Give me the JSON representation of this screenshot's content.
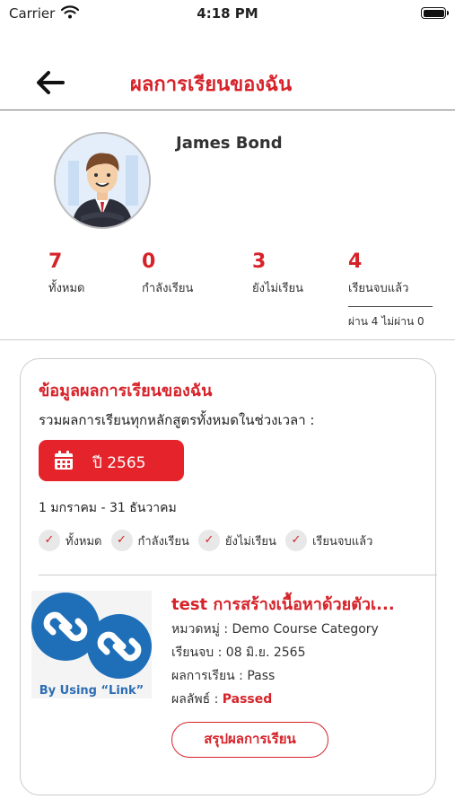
{
  "status_bar": {
    "carrier": "Carrier",
    "time": "4:18 PM"
  },
  "header": {
    "title": "ผลการเรียนของฉัน"
  },
  "profile": {
    "name": "James Bond"
  },
  "stats": [
    {
      "value": "7",
      "label": "ทั้งหมด"
    },
    {
      "value": "0",
      "label": "กำลังเรียน"
    },
    {
      "value": "3",
      "label": "ยังไม่เรียน"
    },
    {
      "value": "4",
      "label": "เรียนจบแล้ว"
    }
  ],
  "pass_summary": "ผ่าน 4 ไม่ผ่าน 0",
  "card": {
    "title": "ข้อมูลผลการเรียนของฉัน",
    "subtitle": "รวมผลการเรียนทุกหลักสูตรทั้งหมดในช่วงเวลา :",
    "year_label": "ปี 2565",
    "date_range": "1 มกราคม -  31 ธันวาคม",
    "filters": [
      "ทั้งหมด",
      "กำลังเรียน",
      "ยังไม่เรียน",
      "เรียนจบแล้ว"
    ],
    "check_symbol": "✓"
  },
  "course": {
    "title": "test การสร้างเนื้อหาด้วยตัวเ...",
    "thumbnail_caption": "By Using “Link”",
    "category_label": "หมวดหมู่ : ",
    "category_value": "Demo Course Category",
    "completed_label": "เรียนจบ : ",
    "completed_value": "08 มิ.ย. 2565",
    "result_label": "ผลการเรียน : ",
    "result_value": "Pass",
    "outcome_label": "ผลลัพธ์ : ",
    "outcome_value": "Passed",
    "summary_button": "สรุปผลการเรียน"
  },
  "colors": {
    "accent": "#d6232a",
    "button_red": "#e5232b",
    "link_blue": "#1f6fb8"
  },
  "icons": [
    "wifi-icon",
    "battery-icon",
    "back-arrow-icon",
    "calendar-icon",
    "check-icon",
    "link-icon"
  ]
}
